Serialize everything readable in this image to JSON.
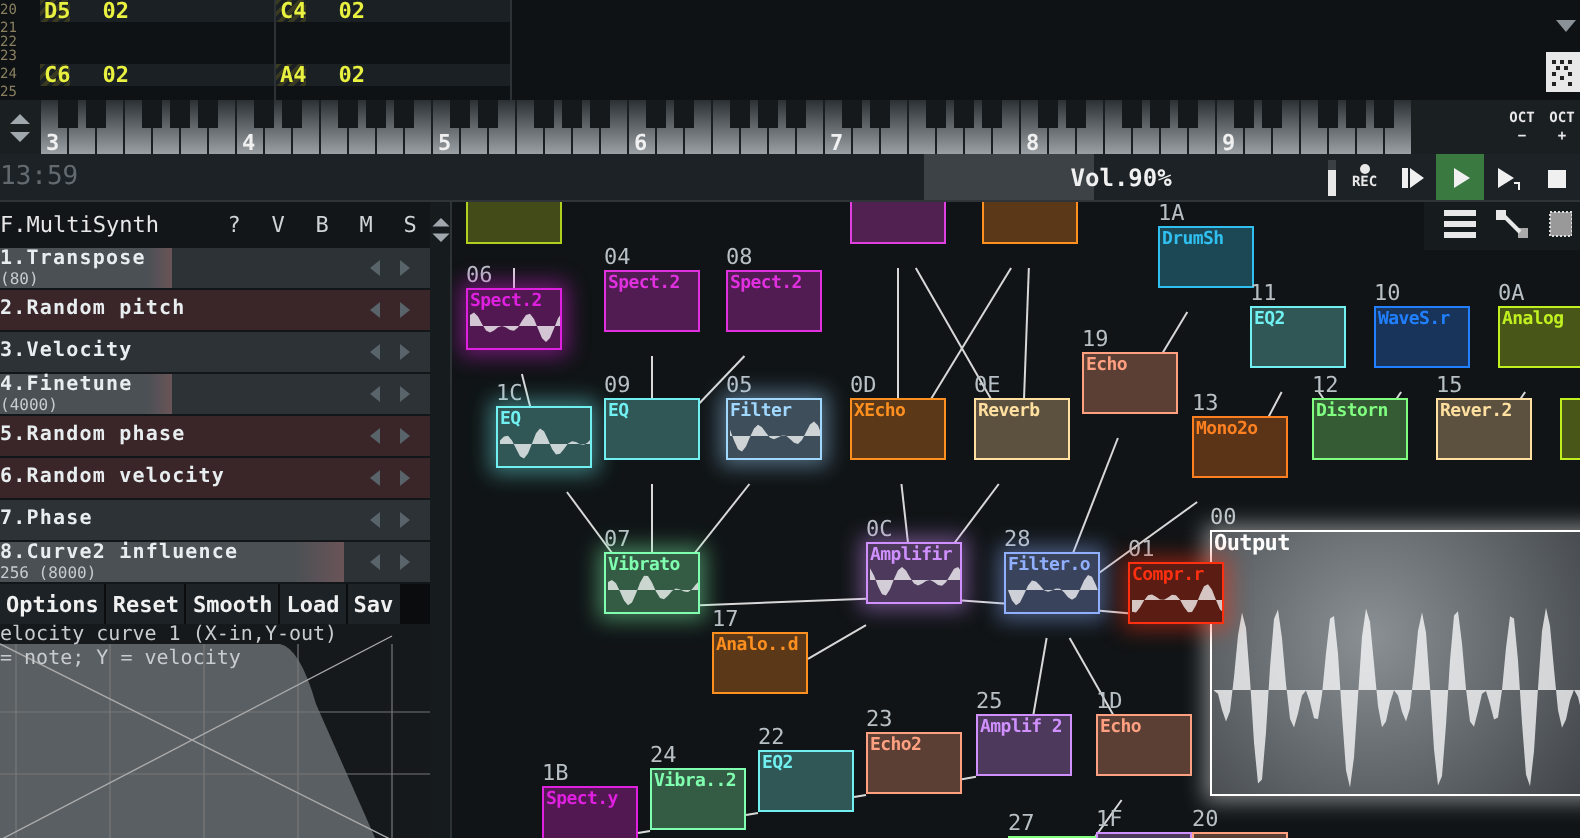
{
  "pattern": {
    "rows": [
      {
        "line": "20",
        "cells": [
          {
            "note": "D5",
            "velocity": "02"
          },
          {
            "note": "C4",
            "velocity": "02"
          }
        ]
      },
      {
        "line": "21",
        "cells": []
      },
      {
        "line": "22",
        "cells": []
      },
      {
        "line": "23",
        "cells": []
      },
      {
        "line": "24",
        "cells": [
          {
            "note": "C6",
            "velocity": "02"
          },
          {
            "note": "A4",
            "velocity": "02"
          }
        ]
      },
      {
        "line": "25",
        "cells": []
      }
    ]
  },
  "keyboard": {
    "octaves": [
      "3",
      "4",
      "5",
      "6",
      "7",
      "8",
      "9"
    ],
    "octave_buttons": [
      {
        "label": "OCT",
        "sign": "−"
      },
      {
        "label": "OCT",
        "sign": "+"
      }
    ]
  },
  "transport": {
    "time": "13:59",
    "volume": {
      "label": "Vol.90%",
      "level": 0.43
    },
    "rec_label": "REC",
    "playing": true
  },
  "module_panel": {
    "title": "F.MultiSynth",
    "header_buttons": [
      "?",
      "V",
      "B",
      "M",
      "S"
    ],
    "controllers": [
      {
        "name": "1.Transpose",
        "value": "(80)",
        "level": 0.4,
        "color": "#2c3236"
      },
      {
        "name": "2.Random pitch",
        "level": 0,
        "color": "#3a2628"
      },
      {
        "name": "3.Velocity",
        "level": 0,
        "color": "#2c3236"
      },
      {
        "name": "4.Finetune",
        "value": "(4000)",
        "level": 0.4,
        "color": "#2c3236"
      },
      {
        "name": "5.Random phase",
        "level": 0,
        "color": "#3a2628"
      },
      {
        "name": "6.Random velocity",
        "level": 0,
        "color": "#3a2628"
      },
      {
        "name": "7.Phase",
        "level": 0,
        "color": "#2c3236"
      },
      {
        "name": "8.Curve2 influence",
        "value": "256 (8000)",
        "level": 0.8,
        "color": "#2c3236"
      }
    ],
    "buttons": [
      "Options",
      "Reset",
      "Smooth",
      "Load",
      "Sav"
    ],
    "curve": {
      "title": "elocity curve 1 (X-in,Y-out)",
      "subtitle": "= note; Y = velocity"
    }
  },
  "modules": [
    {
      "kind": "module",
      "color": "#b0d020",
      "active": false
    },
    {
      "kind": "module",
      "color": "#e040e0",
      "active": false
    },
    {
      "kind": "module",
      "color": "#ff9020",
      "active": false
    },
    {
      "kind": "module",
      "id": "1A",
      "name": "DrumSh",
      "color": "#30c0f0",
      "active": false
    },
    {
      "kind": "module",
      "id": "06",
      "name": "Spect.2",
      "color": "#e020e0",
      "active": true
    },
    {
      "kind": "module",
      "id": "04",
      "name": "Spect.2",
      "color": "#e030e0",
      "active": false
    },
    {
      "kind": "module",
      "id": "08",
      "name": "Spect.2",
      "color": "#e030e0",
      "active": false
    },
    {
      "kind": "module",
      "id": "1C",
      "name": "EQ",
      "color": "#70f0f0",
      "active": true
    },
    {
      "kind": "module",
      "id": "09",
      "name": "EQ",
      "color": "#70f0f0",
      "active": false
    },
    {
      "kind": "module",
      "id": "05",
      "name": "Filter",
      "color": "#a0d8ff",
      "active": true
    },
    {
      "kind": "module",
      "id": "0D",
      "name": "XEcho",
      "color": "#ff9020",
      "active": false
    },
    {
      "kind": "module",
      "id": "0E",
      "name": "Reverb",
      "color": "#ffe0a0",
      "active": false
    },
    {
      "kind": "module",
      "id": "19",
      "name": "Echo",
      "color": "#ffa080",
      "active": false
    },
    {
      "kind": "module",
      "id": "13",
      "name": "Mono2o",
      "color": "#ff8020",
      "active": false
    },
    {
      "kind": "module",
      "id": "11",
      "name": "EQ2",
      "color": "#70f0f0",
      "active": false
    },
    {
      "kind": "module",
      "id": "10",
      "name": "WaveS.r",
      "color": "#2080ff",
      "active": false
    },
    {
      "kind": "module",
      "id": "0A",
      "name": "Analog",
      "color": "#c0f020",
      "active": false
    },
    {
      "kind": "module",
      "id": "12",
      "name": "Distorn",
      "color": "#80ff80",
      "active": false
    },
    {
      "kind": "module",
      "id": "15",
      "name": "Rever.2",
      "color": "#ffe0a0",
      "active": false
    },
    {
      "kind": "module",
      "color": "#c0f020",
      "active": false
    },
    {
      "kind": "module",
      "id": "07",
      "name": "Vibrato",
      "color": "#80ffb0",
      "active": true
    },
    {
      "kind": "module",
      "id": "0C",
      "name": "Amplifir",
      "color": "#d090ff",
      "active": true
    },
    {
      "kind": "module",
      "id": "28",
      "name": "Filter.o",
      "color": "#90b0ff",
      "active": true
    },
    {
      "kind": "module",
      "id": "01",
      "name": "Compr.r",
      "color": "#ff3010",
      "active": true
    },
    {
      "kind": "module",
      "id": "17",
      "name": "Analo..d",
      "color": "#ff9020",
      "active": false
    },
    {
      "kind": "output",
      "id": "00",
      "name": "Output",
      "color": "#ffffff",
      "active": true
    },
    {
      "kind": "module",
      "id": "25",
      "name": "Amplif 2",
      "color": "#d090ff",
      "active": false
    },
    {
      "kind": "module",
      "id": "1D",
      "name": "Echo",
      "color": "#ffa080",
      "active": false
    },
    {
      "kind": "module",
      "id": "23",
      "name": "Echo2",
      "color": "#ffa080",
      "active": false
    },
    {
      "kind": "module",
      "id": "22",
      "name": "EQ2",
      "color": "#70f0f0",
      "active": false
    },
    {
      "kind": "module",
      "id": "24",
      "name": "Vibra..2",
      "color": "#80ffb0",
      "active": false
    },
    {
      "kind": "module",
      "id": "1B",
      "name": "Spect.y",
      "color": "#e020e0",
      "active": false
    },
    {
      "kind": "module",
      "id": "27",
      "color": "#80ff80",
      "active": false
    },
    {
      "kind": "module",
      "id": "1F",
      "color": "#d090ff",
      "active": false
    },
    {
      "kind": "module",
      "id": "20",
      "color": "#ffa080",
      "active": false
    }
  ]
}
